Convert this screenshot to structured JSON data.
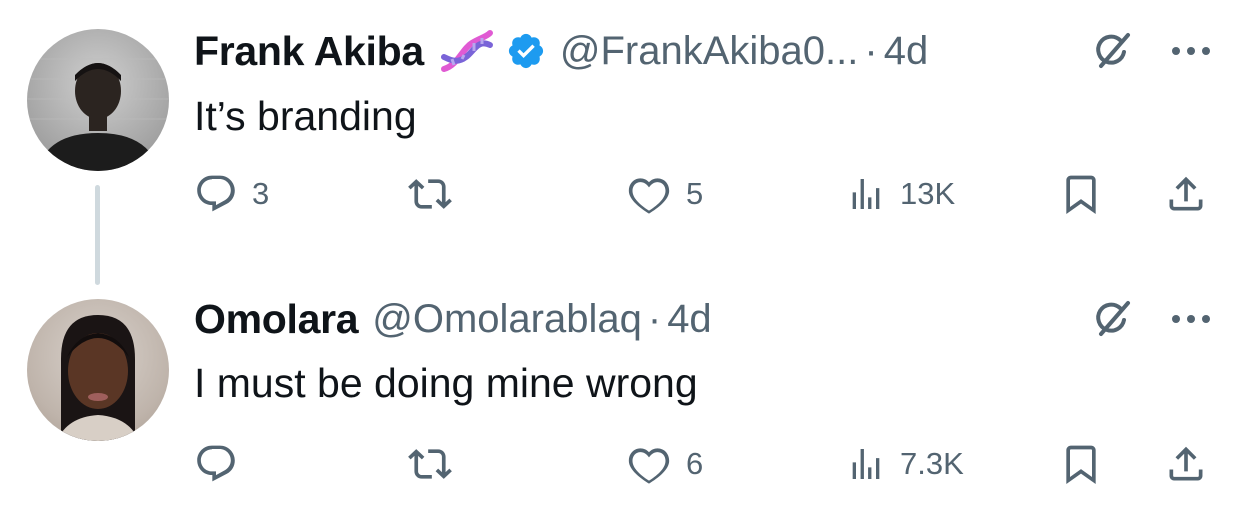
{
  "tweets": [
    {
      "name": "Frank Akiba",
      "name_emoji": "dna-emoji",
      "verified": true,
      "handle": "@FrankAkiba0...",
      "separator": "·",
      "time": "4d",
      "text": "It’s branding",
      "reply_count": "3",
      "retweet_count": "",
      "like_count": "5",
      "view_count": "13K"
    },
    {
      "name": "Omolara",
      "verified": false,
      "handle": "@Omolarablaq",
      "separator": "·",
      "time": "4d",
      "text": "I must be doing mine wrong",
      "reply_count": "",
      "retweet_count": "",
      "like_count": "6",
      "view_count": "7.3K"
    }
  ],
  "icons": {
    "reply": "reply-icon",
    "retweet": "retweet-icon",
    "like": "heart-icon",
    "views": "views-icon",
    "bookmark": "bookmark-icon",
    "share": "share-icon",
    "grok": "grok-icon",
    "more": "more-icon",
    "verified": "verified-badge-icon"
  },
  "colors": {
    "text": "#0f1419",
    "secondary": "#536471",
    "verified": "#1d9bf0",
    "thread_line": "#cfd9de"
  }
}
